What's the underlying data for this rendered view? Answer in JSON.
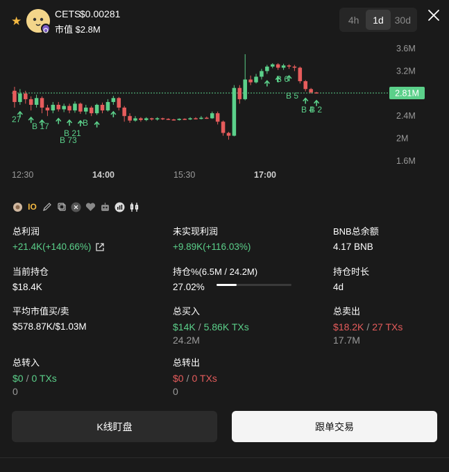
{
  "header": {
    "token_name": "CETS",
    "token_price": "$0.00281",
    "mcap_label": "市值 $2.8M",
    "timeframes": [
      "4h",
      "1d",
      "30d"
    ],
    "active_timeframe": "1d"
  },
  "chart_data": {
    "type": "candlestick",
    "x_ticks": [
      "12:30",
      "14:00",
      "15:30",
      "17:00"
    ],
    "y_ticks": [
      "3.6M",
      "3.2M",
      "2.8M",
      "2.4M",
      "2M",
      "1.6M"
    ],
    "ylim": [
      1.6,
      3.6
    ],
    "y_unit": "M",
    "current_value": "2.81M",
    "current_value_num": 2.81,
    "up_color": "#5bd08a",
    "down_color": "#e65c5c",
    "trade_labels": [
      "27",
      "B 17",
      "B 21",
      "B 73",
      "B",
      "B 5",
      "B 6",
      "B 4",
      "B 2"
    ],
    "candles": [
      {
        "o": 2.85,
        "c": 2.65,
        "h": 2.92,
        "l": 2.55
      },
      {
        "o": 2.65,
        "c": 2.8,
        "h": 2.88,
        "l": 2.6
      },
      {
        "o": 2.8,
        "c": 2.7,
        "h": 2.85,
        "l": 2.62
      },
      {
        "o": 2.7,
        "c": 2.6,
        "h": 2.75,
        "l": 2.5
      },
      {
        "o": 2.6,
        "c": 2.72,
        "h": 2.78,
        "l": 2.55
      },
      {
        "o": 2.72,
        "c": 2.55,
        "h": 2.75,
        "l": 2.45
      },
      {
        "o": 2.55,
        "c": 2.5,
        "h": 2.6,
        "l": 2.4
      },
      {
        "o": 2.5,
        "c": 2.6,
        "h": 2.65,
        "l": 2.45
      },
      {
        "o": 2.6,
        "c": 2.52,
        "h": 2.65,
        "l": 2.48
      },
      {
        "o": 2.52,
        "c": 2.58,
        "h": 2.62,
        "l": 2.47
      },
      {
        "o": 2.58,
        "c": 2.5,
        "h": 2.62,
        "l": 2.45
      },
      {
        "o": 2.5,
        "c": 2.62,
        "h": 2.66,
        "l": 2.46
      },
      {
        "o": 2.62,
        "c": 2.48,
        "h": 2.64,
        "l": 2.44
      },
      {
        "o": 2.48,
        "c": 2.55,
        "h": 2.6,
        "l": 2.43
      },
      {
        "o": 2.55,
        "c": 2.45,
        "h": 2.58,
        "l": 2.4
      },
      {
        "o": 2.45,
        "c": 2.6,
        "h": 2.62,
        "l": 2.42
      },
      {
        "o": 2.6,
        "c": 2.5,
        "h": 2.64,
        "l": 2.45
      },
      {
        "o": 2.5,
        "c": 2.65,
        "h": 2.7,
        "l": 2.48
      },
      {
        "o": 2.65,
        "c": 2.72,
        "h": 2.76,
        "l": 2.6
      },
      {
        "o": 2.72,
        "c": 2.55,
        "h": 2.74,
        "l": 2.5
      },
      {
        "o": 2.55,
        "c": 2.4,
        "h": 2.58,
        "l": 2.3
      },
      {
        "o": 2.4,
        "c": 2.32,
        "h": 2.45,
        "l": 2.28
      },
      {
        "o": 2.32,
        "c": 2.36,
        "h": 2.4,
        "l": 2.3
      },
      {
        "o": 2.36,
        "c": 2.33,
        "h": 2.38,
        "l": 2.3
      },
      {
        "o": 2.33,
        "c": 2.36,
        "h": 2.38,
        "l": 2.31
      },
      {
        "o": 2.36,
        "c": 2.34,
        "h": 2.37,
        "l": 2.32
      },
      {
        "o": 2.34,
        "c": 2.36,
        "h": 2.38,
        "l": 2.32
      },
      {
        "o": 2.36,
        "c": 2.35,
        "h": 2.37,
        "l": 2.33
      },
      {
        "o": 2.35,
        "c": 2.34,
        "h": 2.36,
        "l": 2.33
      },
      {
        "o": 2.34,
        "c": 2.33,
        "h": 2.35,
        "l": 2.32
      },
      {
        "o": 2.33,
        "c": 2.35,
        "h": 2.36,
        "l": 2.32
      },
      {
        "o": 2.35,
        "c": 2.34,
        "h": 2.36,
        "l": 2.33
      },
      {
        "o": 2.34,
        "c": 2.36,
        "h": 2.38,
        "l": 2.33
      },
      {
        "o": 2.36,
        "c": 2.35,
        "h": 2.38,
        "l": 2.34
      },
      {
        "o": 2.35,
        "c": 2.37,
        "h": 2.4,
        "l": 2.34
      },
      {
        "o": 2.37,
        "c": 2.36,
        "h": 2.39,
        "l": 2.35
      },
      {
        "o": 2.36,
        "c": 2.45,
        "h": 2.48,
        "l": 2.35
      },
      {
        "o": 2.45,
        "c": 2.3,
        "h": 2.48,
        "l": 2.25
      },
      {
        "o": 2.3,
        "c": 2.1,
        "h": 2.32,
        "l": 2.05
      },
      {
        "o": 2.1,
        "c": 2.05,
        "h": 2.12,
        "l": 1.98
      },
      {
        "o": 2.05,
        "c": 2.9,
        "h": 2.95,
        "l": 2.04
      },
      {
        "o": 2.9,
        "c": 2.7,
        "h": 2.95,
        "l": 2.62
      },
      {
        "o": 2.7,
        "c": 3.05,
        "h": 3.5,
        "l": 2.68
      },
      {
        "o": 3.05,
        "c": 3.0,
        "h": 3.12,
        "l": 2.95
      },
      {
        "o": 3.0,
        "c": 3.1,
        "h": 3.15,
        "l": 2.98
      },
      {
        "o": 3.1,
        "c": 3.2,
        "h": 3.24,
        "l": 3.05
      },
      {
        "o": 3.2,
        "c": 3.28,
        "h": 3.31,
        "l": 3.15
      },
      {
        "o": 3.28,
        "c": 3.32,
        "h": 3.34,
        "l": 3.25
      },
      {
        "o": 3.32,
        "c": 3.26,
        "h": 3.34,
        "l": 3.22
      },
      {
        "o": 3.26,
        "c": 3.3,
        "h": 3.33,
        "l": 3.22
      },
      {
        "o": 3.3,
        "c": 3.28,
        "h": 3.32,
        "l": 3.24
      },
      {
        "o": 3.28,
        "c": 3.26,
        "h": 3.31,
        "l": 3.2
      },
      {
        "o": 3.26,
        "c": 3.02,
        "h": 3.28,
        "l": 2.98
      },
      {
        "o": 3.02,
        "c": 2.88,
        "h": 3.04,
        "l": 2.84
      },
      {
        "o": 2.88,
        "c": 2.82,
        "h": 2.9,
        "l": 2.8
      },
      {
        "o": 2.82,
        "c": 2.81,
        "h": 2.83,
        "l": 2.8
      }
    ]
  },
  "stats_icons": {
    "io_label": "IO"
  },
  "stats": {
    "total_pnl_label": "总利润",
    "total_pnl_value": "+21.4K(+140.66%)",
    "unrealized_label": "未实现利润",
    "unrealized_value": "+9.89K(+116.03%)",
    "bnb_label": "BNB总余额",
    "bnb_value": "4.17 BNB",
    "position_label": "当前持仓",
    "position_value": "$18.4K",
    "hold_pct_label": "持仓%(6.5M / 24.2M)",
    "hold_pct_value": "27.02%",
    "hold_pct_fraction": 0.27,
    "hold_time_label": "持仓时长",
    "hold_time_value": "4d",
    "avg_label": "平均市值买/卖",
    "avg_value": "$578.87K/$1.03M",
    "total_buy_label": "总买入",
    "total_buy_usd": "$14K",
    "total_buy_txs": "5.86K TXs",
    "total_buy_sub": "24.2M",
    "total_sell_label": "总卖出",
    "total_sell_usd": "$18.2K",
    "total_sell_txs": "27 TXs",
    "total_sell_sub": "17.7M",
    "transfer_in_label": "总转入",
    "transfer_in_usd": "$0",
    "transfer_in_txs": "0 TXs",
    "transfer_in_sub": "0",
    "transfer_out_label": "总转出",
    "transfer_out_usd": "$0",
    "transfer_out_txs": "0 TXs",
    "transfer_out_sub": "0",
    "slash": "/"
  },
  "buttons": {
    "kline_label": "K线盯盘",
    "copy_trade_label": "跟单交易"
  }
}
